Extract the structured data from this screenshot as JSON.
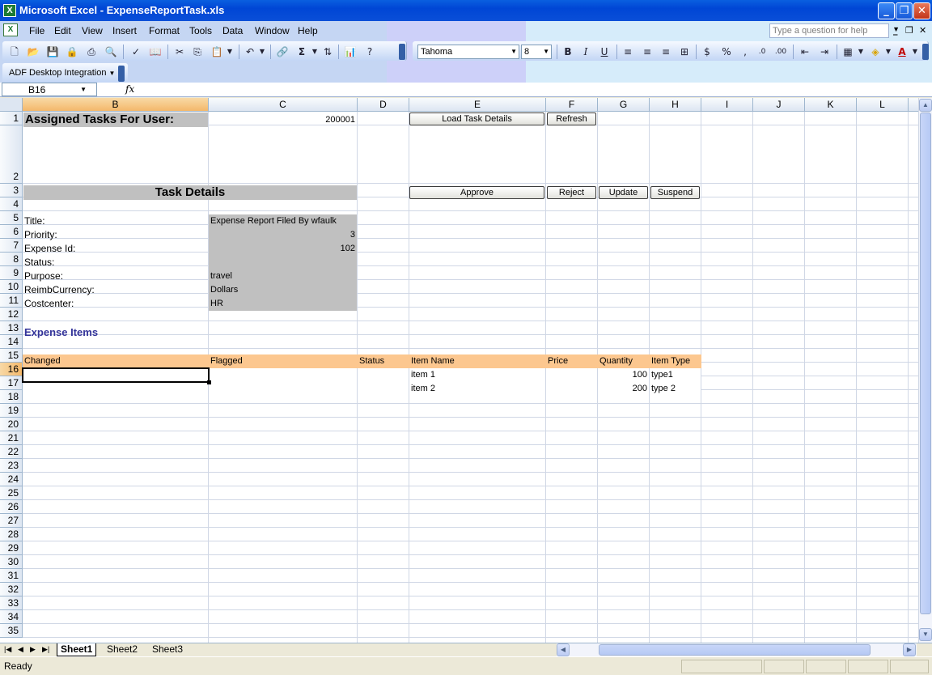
{
  "window": {
    "title": "Microsoft Excel - ExpenseReportTask.xls"
  },
  "menu": [
    "File",
    "Edit",
    "View",
    "Insert",
    "Format",
    "Tools",
    "Data",
    "Window",
    "Help"
  ],
  "help_box": {
    "placeholder": "Type a question for help"
  },
  "format_toolbar": {
    "font": "Tahoma",
    "font_size": "8"
  },
  "adf_toolbar": {
    "label": "ADF Desktop Integration"
  },
  "formula_bar": {
    "name_box": "B16",
    "fx_label": "fx",
    "value": ""
  },
  "columns": [
    "B",
    "C",
    "D",
    "E",
    "F",
    "G",
    "H",
    "I",
    "J",
    "K",
    "L"
  ],
  "rows": [
    "1",
    "2",
    "3",
    "4",
    "5",
    "6",
    "7",
    "8",
    "9",
    "10",
    "11",
    "12",
    "13",
    "14",
    "15",
    "16",
    "17",
    "18",
    "19",
    "20",
    "21",
    "22",
    "23",
    "24",
    "25",
    "26",
    "27",
    "28",
    "29",
    "30",
    "31",
    "32",
    "33",
    "34",
    "35"
  ],
  "sheet": {
    "assigned_label": "Assigned Tasks For User:",
    "user_id": "200001",
    "buttons": {
      "load": "Load Task Details",
      "refresh": "Refresh",
      "approve": "Approve",
      "reject": "Reject",
      "update": "Update",
      "suspend": "Suspend"
    },
    "task_details_header": "Task Details",
    "fields": [
      {
        "label": "Title:",
        "value": "Expense Report Filed By wfaulk"
      },
      {
        "label": "Priority:",
        "value": "3"
      },
      {
        "label": "Expense Id:",
        "value": "102"
      },
      {
        "label": "Status:",
        "value": ""
      },
      {
        "label": "Purpose:",
        "value": "travel"
      },
      {
        "label": "ReimbCurrency:",
        "value": "Dollars"
      },
      {
        "label": "Costcenter:",
        "value": "HR"
      }
    ],
    "expense_items_header": "Expense Items",
    "table_headers": [
      "Changed",
      "Flagged",
      "Status",
      "Item Name",
      "Price",
      "Quantity",
      "Item Type"
    ],
    "table_rows": [
      {
        "changed": "",
        "flagged": "",
        "status": "",
        "item_name": "item 1",
        "price": "",
        "quantity": "100",
        "item_type": "type1"
      },
      {
        "changed": "",
        "flagged": "",
        "status": "",
        "item_name": "item 2",
        "price": "",
        "quantity": "200",
        "item_type": "type 2"
      }
    ]
  },
  "sheet_tabs": [
    "Sheet1",
    "Sheet2",
    "Sheet3"
  ],
  "active_sheet": "Sheet1",
  "status": "Ready"
}
